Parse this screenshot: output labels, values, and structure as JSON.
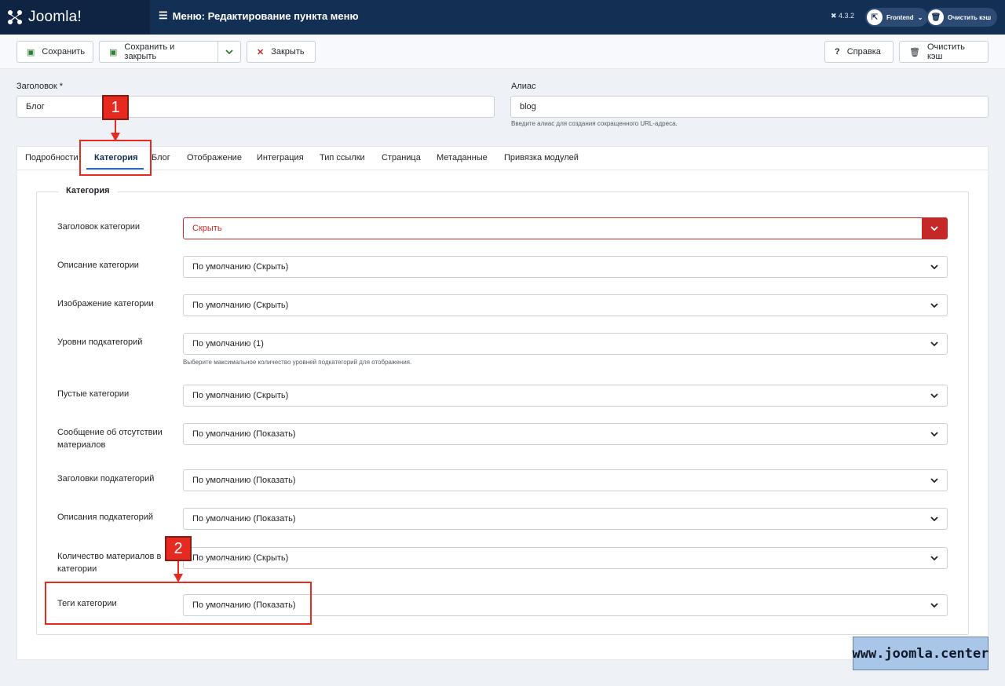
{
  "header": {
    "brand": "Joomla!",
    "title": "Меню: Редактирование пункта меню",
    "version": "4.3.2",
    "frontend_label": "Frontend",
    "clear_cache_label": "Очистить кэш"
  },
  "toolbar": {
    "save": "Сохранить",
    "save_close": "Сохранить и закрыть",
    "close": "Закрыть",
    "help": "Справка",
    "clear_cache": "Очистить кэш"
  },
  "form": {
    "title_label": "Заголовок *",
    "title_value": "Блог",
    "alias_label": "Алиас",
    "alias_value": "blog",
    "alias_hint": "Введите алиас для создания сокращенного URL-адреса."
  },
  "tabs": [
    "Подробности",
    "Категория",
    "Блог",
    "Отображение",
    "Интеграция",
    "Тип ссылки",
    "Страница",
    "Метаданные",
    "Привязка модулей"
  ],
  "active_tab": "Категория",
  "fieldset_legend": "Категория",
  "fields": [
    {
      "label": "Заголовок категории",
      "value": "Скрыть"
    },
    {
      "label": "Описание категории",
      "value": "По умолчанию (Скрыть)"
    },
    {
      "label": "Изображение категории",
      "value": "По умолчанию (Скрыть)"
    },
    {
      "label": "Уровни подкатегорий",
      "value": "По умолчанию (1)",
      "hint": "Выберите максимальное количество уровней подкатегорий для отображения."
    },
    {
      "label": "Пустые категории",
      "value": "По умолчанию (Скрыть)"
    },
    {
      "label": "Сообщение об отсутствии материалов",
      "value": "По умолчанию (Показать)"
    },
    {
      "label": "Заголовки подкатегорий",
      "value": "По умолчанию (Показать)"
    },
    {
      "label": "Описания подкатегорий",
      "value": "По умолчанию (Показать)"
    },
    {
      "label": "Количество материалов в категории",
      "value": "По умолчанию (Скрыть)"
    },
    {
      "label": "Теги категории",
      "value": "По умолчанию (Показать)"
    }
  ],
  "annotations": {
    "marker1": "1",
    "marker2": "2"
  },
  "watermark": "www.joomla.center",
  "colors": {
    "header": "#132f53",
    "danger": "#c52827",
    "save_icon": "#2f8132",
    "annotation": "#e62a20"
  }
}
